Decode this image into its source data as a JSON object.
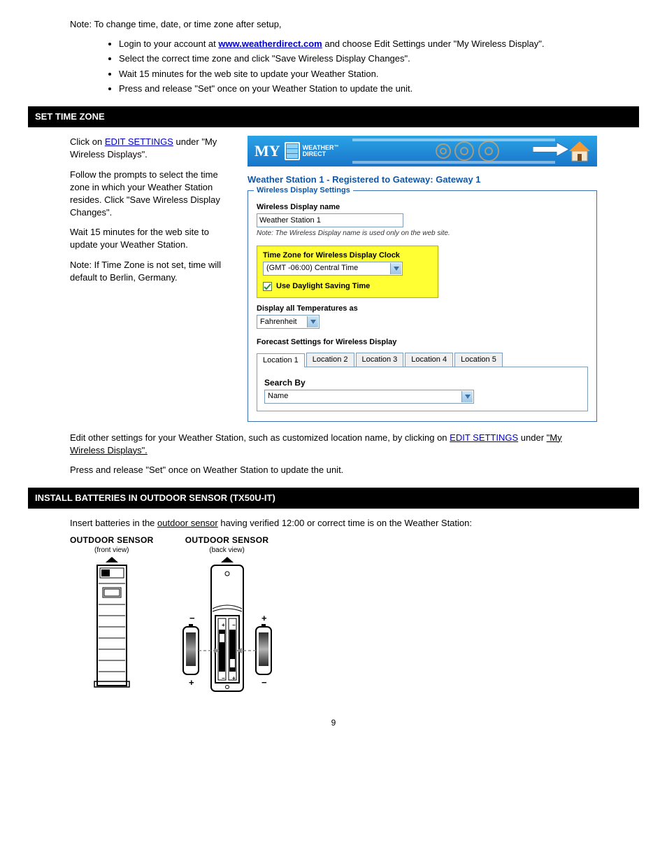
{
  "top_note": "Note: To change time, date, or time zone after setup,",
  "bullets": [
    {
      "pre": "Login to your account at ",
      "link": "www.weatherdirect.com",
      "post": " and choose Edit Settings under \"My Wireless Display\"."
    },
    {
      "text": "Select the correct time zone and click \"Save Wireless Display Changes\"."
    },
    {
      "text": "Wait 15 minutes for the web site to update your Weather Station."
    },
    {
      "text": "Press and release \"Set\" once on your Weather Station to update the unit."
    }
  ],
  "section_time_zone": "SET TIME ZONE",
  "tz_left": {
    "p1_pre": "Click on ",
    "p1_link": "EDIT SETTINGS",
    "p1_post": " under \"My Wireless Displays\".",
    "p2": "Follow the prompts to select the time zone in which your Weather Station resides. Click \"Save Wireless Display Changes\".",
    "p3": "Wait 15 minutes for the web site to update your Weather Station.",
    "p4": "Note: If Time Zone is not set, time will default to Berlin, Germany."
  },
  "banner": {
    "brand1": "MY",
    "brand2a": "WEATHER",
    "brand2b": "DIRECT",
    "tm": "™"
  },
  "settings_title_pre": "Weather Station 1 - Registered to Gateway: ",
  "settings_title_gw": "Gateway 1",
  "legend": "Wireless Display Settings",
  "disp_name_label": "Wireless Display name",
  "disp_name_value": "Weather Station 1",
  "disp_name_note": "Note: The Wireless Display name is used only on the web site.",
  "tz_label": "Time Zone for Wireless Display Clock",
  "tz_value": "(GMT -06:00) Central Time",
  "dst_label": "Use Daylight Saving Time",
  "temp_label": "Display all Temperatures as",
  "temp_value": "Fahrenheit",
  "forecast_label": "Forecast Settings for Wireless Display",
  "tabs": [
    "Location 1",
    "Location 2",
    "Location 3",
    "Location 4",
    "Location 5"
  ],
  "search_by_label": "Search By",
  "search_by_value": "Name",
  "after": {
    "p1_pre": "Edit other settings for your Weather Station, such as customized location name, by clicking on ",
    "p1_link": "EDIT SETTINGS",
    "p1_post": " under ",
    "p1_u": "\"My Wireless Displays\".",
    "p2": "Press and release \"Set\" once on Weather Station to update the unit."
  },
  "section_sensor": "INSTALL BATTERIES IN OUTDOOR SENSOR (TX50U-IT)",
  "sensor_intro_a": "Insert batteries in the ",
  "sensor_intro_b": "outdoor sensor",
  "sensor_intro_c": " having verified 12:00 or correct time is on the Weather Station:",
  "sensor_front": {
    "title": "OUTDOOR SENSOR",
    "sub": "(front view)"
  },
  "sensor_back": {
    "title": "OUTDOOR SENSOR",
    "sub": "(back view)"
  },
  "page_number": "9"
}
